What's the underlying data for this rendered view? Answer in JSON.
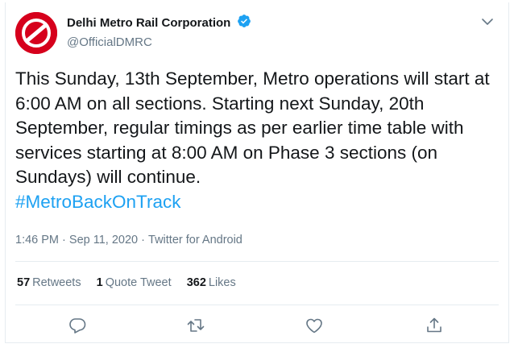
{
  "account": {
    "name": "Delhi Metro Rail Corporation",
    "handle": "@OfficialDMRC",
    "verified": true,
    "avatar_color": "#d6001c"
  },
  "tweet": {
    "text": "This Sunday, 13th September, Metro operations will start at 6:00 AM on all sections. Starting next Sunday, 20th September, regular timings as per earlier time table with services starting at 8:00 AM on Phase 3 sections (on Sundays) will continue.",
    "hashtag": "#MetroBackOnTrack",
    "time": "1:46 PM",
    "date": "Sep 11, 2020",
    "source": "Twitter for Android",
    "dot": "·"
  },
  "stats": {
    "retweets_count": "57",
    "retweets_label": "Retweets",
    "quotes_count": "1",
    "quotes_label": "Quote Tweet",
    "likes_count": "362",
    "likes_label": "Likes"
  },
  "icons": {
    "menu": "chevron-down-icon",
    "reply": "reply-icon",
    "retweet": "retweet-icon",
    "like": "heart-icon",
    "share": "share-icon",
    "verified": "verified-badge-icon"
  },
  "colors": {
    "accent": "#1da1f2",
    "text": "#14171a",
    "secondary": "#657786",
    "border": "#e6ecf0"
  }
}
